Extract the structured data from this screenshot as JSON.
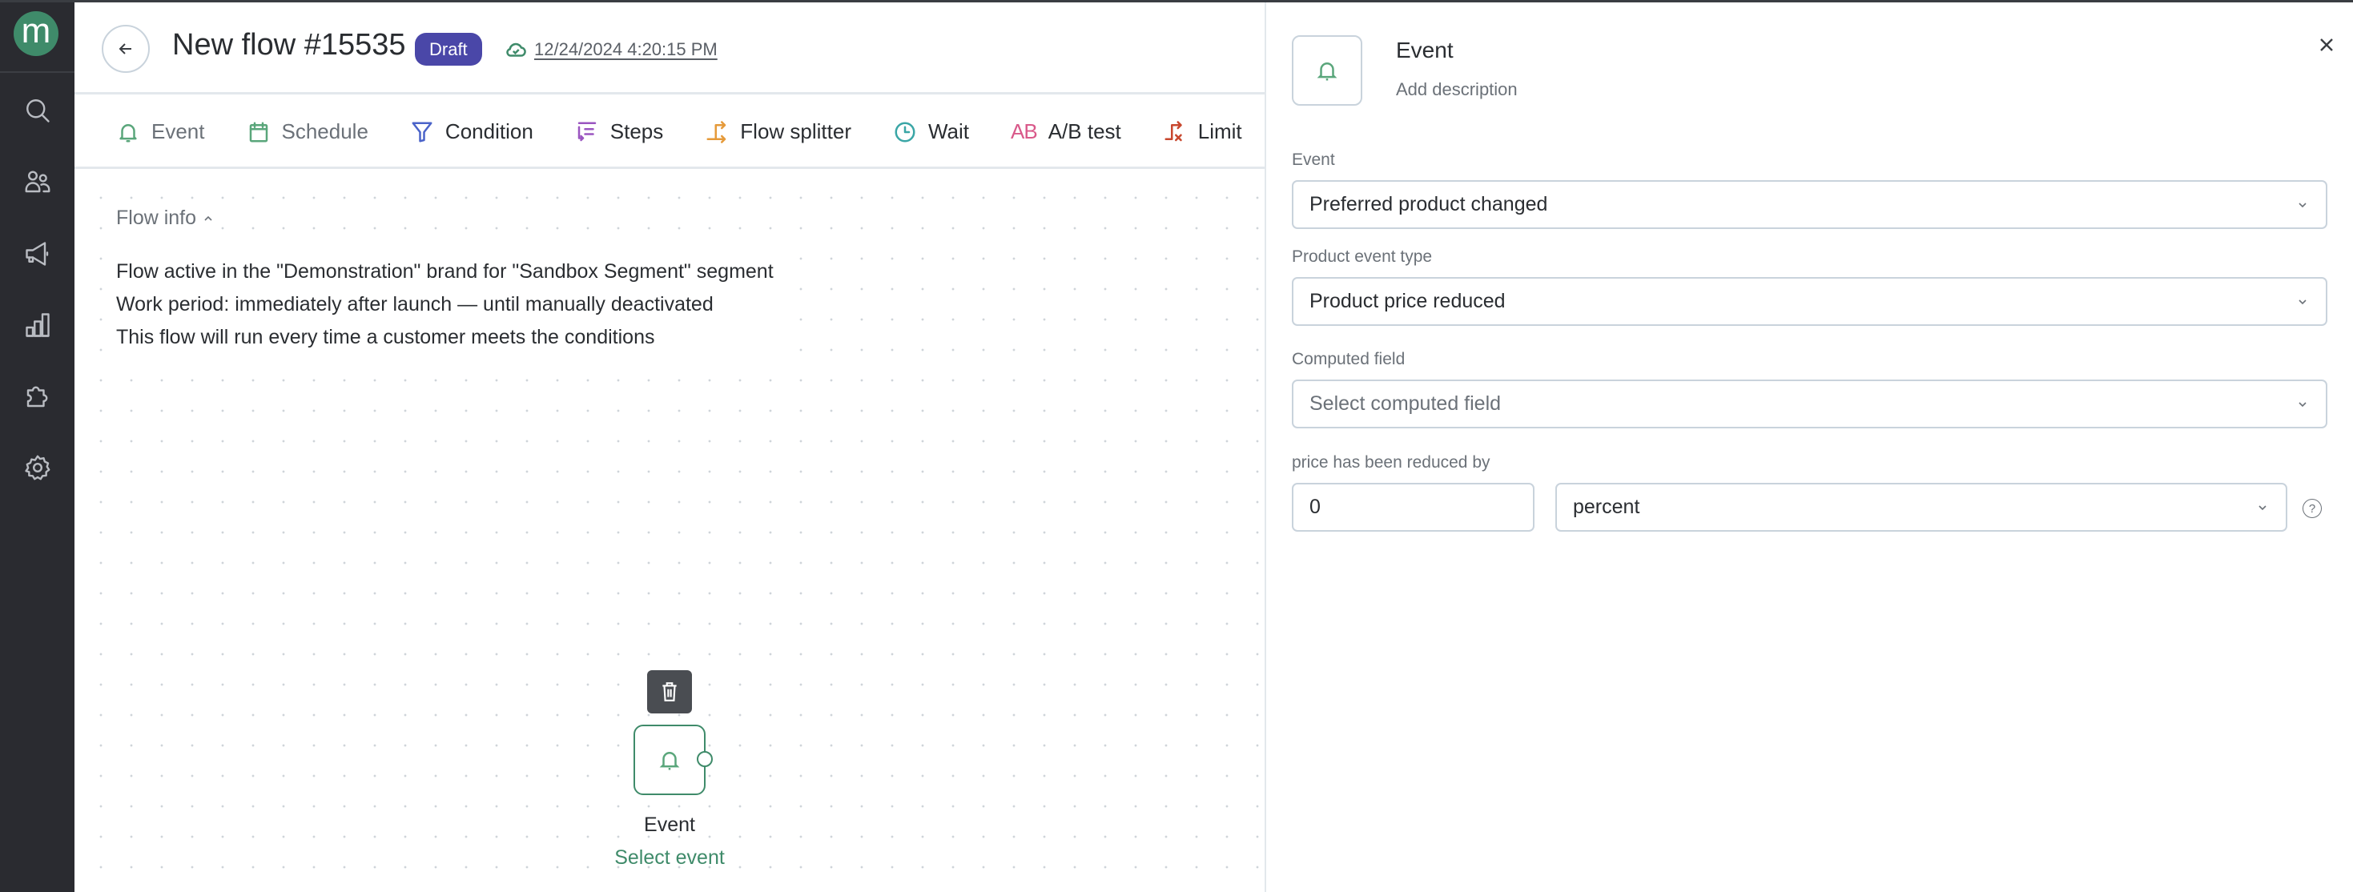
{
  "sidebar": {
    "logo_letter": "m",
    "items": [
      {
        "name": "search",
        "icon": "search-icon"
      },
      {
        "name": "customers",
        "icon": "users-icon"
      },
      {
        "name": "campaigns",
        "icon": "megaphone-icon"
      },
      {
        "name": "analytics",
        "icon": "bar-chart-icon"
      },
      {
        "name": "integrations",
        "icon": "puzzle-icon"
      },
      {
        "name": "settings",
        "icon": "gear-icon"
      }
    ]
  },
  "header": {
    "title": "New flow #15535",
    "status_badge": "Draft",
    "saved_at": "12/24/2024 4:20:15 PM"
  },
  "toolbar": {
    "items": [
      {
        "label": "Event",
        "icon": "bell-icon",
        "color": "#5aa67b",
        "muted": true
      },
      {
        "label": "Schedule",
        "icon": "calendar-icon",
        "color": "#5aa67b",
        "muted": true
      },
      {
        "label": "Condition",
        "icon": "funnel-icon",
        "color": "#4a63c9",
        "muted": false
      },
      {
        "label": "Steps",
        "icon": "steps-icon",
        "color": "#9a55c0",
        "muted": false
      },
      {
        "label": "Flow splitter",
        "icon": "split-icon",
        "color": "#e59a3a",
        "muted": false
      },
      {
        "label": "Wait",
        "icon": "clock-icon",
        "color": "#3aa6a6",
        "muted": false
      },
      {
        "label": "A/B test",
        "icon": "ab-icon",
        "icon_text": "AB",
        "color": "#d9598a",
        "muted": false
      },
      {
        "label": "Limit",
        "icon": "limit-icon",
        "color": "#c8472e",
        "muted": false
      }
    ]
  },
  "canvas": {
    "flow_info_toggle": "Flow info",
    "flow_info_lines": [
      "Flow active in the \"Demonstration\" brand for \"Sandbox Segment\" segment",
      "Work period: immediately after launch — until manually deactivated",
      "This flow will run every time a customer meets the conditions"
    ],
    "node": {
      "label": "Event",
      "action": "Select event"
    }
  },
  "panel": {
    "title": "Event",
    "description_placeholder": "Add description",
    "fields": {
      "event": {
        "label": "Event",
        "value": "Preferred product changed"
      },
      "product_event_type": {
        "label": "Product event type",
        "value": "Product price reduced"
      },
      "computed_field": {
        "label": "Computed field",
        "placeholder": "Select computed field"
      },
      "reduction": {
        "label": "price has been reduced by",
        "amount": "0",
        "unit": "percent"
      }
    },
    "help_glyph": "?"
  },
  "colors": {
    "brand": "#3f8b6a",
    "sidebar_bg": "#2a2b30",
    "draft_badge": "#4a47a8"
  }
}
